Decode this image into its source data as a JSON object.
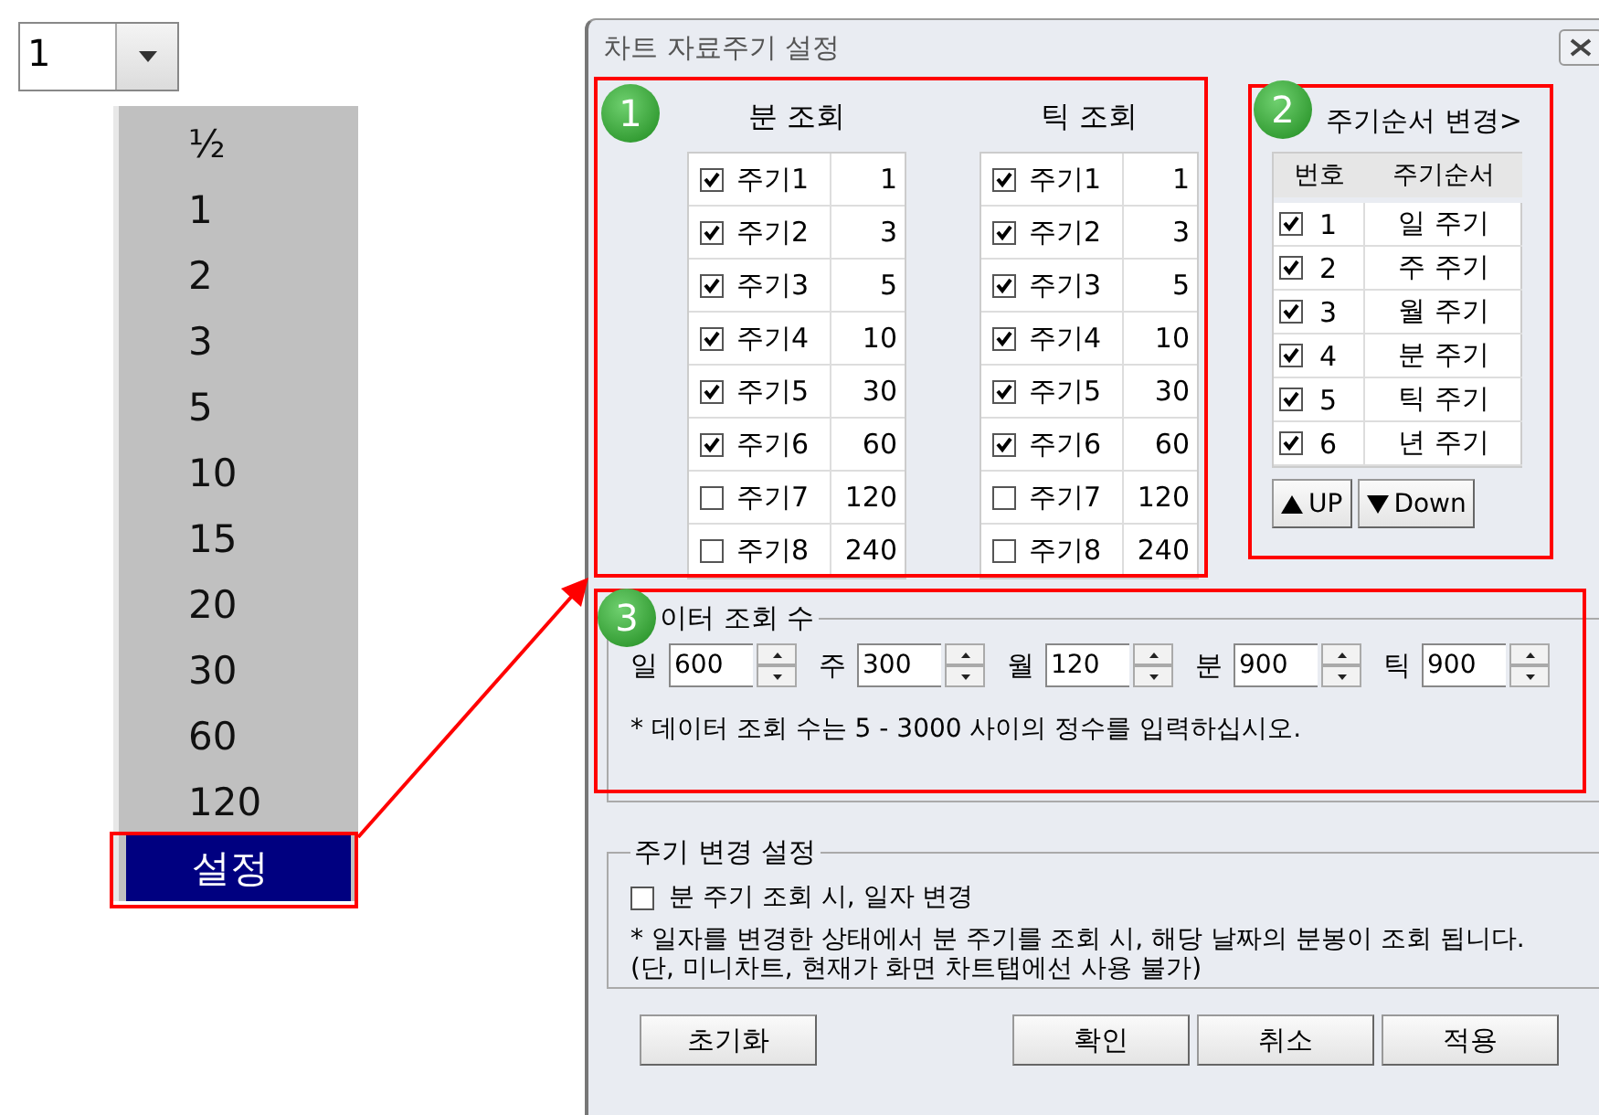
{
  "combo": {
    "value": "1"
  },
  "dropdown": {
    "items": [
      {
        "label": "½",
        "selected": false
      },
      {
        "label": "1",
        "selected": false
      },
      {
        "label": "2",
        "selected": false
      },
      {
        "label": "3",
        "selected": false
      },
      {
        "label": "5",
        "selected": false
      },
      {
        "label": "10",
        "selected": false
      },
      {
        "label": "15",
        "selected": false
      },
      {
        "label": "20",
        "selected": false
      },
      {
        "label": "30",
        "selected": false
      },
      {
        "label": "60",
        "selected": false
      },
      {
        "label": "120",
        "selected": false
      },
      {
        "label": "설정",
        "selected": true
      }
    ]
  },
  "dialog": {
    "title": "차트 자료주기 설정",
    "queries": [
      {
        "heading": "분 조회",
        "rows": [
          {
            "label": "주기1",
            "value": "1",
            "checked": true
          },
          {
            "label": "주기2",
            "value": "3",
            "checked": true
          },
          {
            "label": "주기3",
            "value": "5",
            "checked": true
          },
          {
            "label": "주기4",
            "value": "10",
            "checked": true
          },
          {
            "label": "주기5",
            "value": "30",
            "checked": true
          },
          {
            "label": "주기6",
            "value": "60",
            "checked": true
          },
          {
            "label": "주기7",
            "value": "120",
            "checked": false
          },
          {
            "label": "주기8",
            "value": "240",
            "checked": false
          }
        ]
      },
      {
        "heading": "틱 조회",
        "rows": [
          {
            "label": "주기1",
            "value": "1",
            "checked": true
          },
          {
            "label": "주기2",
            "value": "3",
            "checked": true
          },
          {
            "label": "주기3",
            "value": "5",
            "checked": true
          },
          {
            "label": "주기4",
            "value": "10",
            "checked": true
          },
          {
            "label": "주기5",
            "value": "30",
            "checked": true
          },
          {
            "label": "주기6",
            "value": "60",
            "checked": true
          },
          {
            "label": "주기7",
            "value": "120",
            "checked": false
          },
          {
            "label": "주기8",
            "value": "240",
            "checked": false
          }
        ]
      }
    ],
    "order": {
      "heading": "주기순서 변경>",
      "columns": [
        "번호",
        "주기순서"
      ],
      "rows": [
        {
          "number": "1",
          "name": "일 주기",
          "checked": true
        },
        {
          "number": "2",
          "name": "주 주기",
          "checked": true
        },
        {
          "number": "3",
          "name": "월 주기",
          "checked": true
        },
        {
          "number": "4",
          "name": "분 주기",
          "checked": true
        },
        {
          "number": "5",
          "name": "틱 주기",
          "checked": true
        },
        {
          "number": "6",
          "name": "년 주기",
          "checked": true
        }
      ],
      "buttons": [
        {
          "kind": "up",
          "label": "UP"
        },
        {
          "kind": "down",
          "label": "Down"
        }
      ]
    },
    "data_count": {
      "legend": "이터 조회 수",
      "fields": [
        {
          "label": "일",
          "value": "600"
        },
        {
          "label": "주",
          "value": "300"
        },
        {
          "label": "월",
          "value": "120"
        },
        {
          "label": "분",
          "value": "900"
        },
        {
          "label": "틱",
          "value": "900"
        }
      ],
      "note": "* 데이터 조회 수는 5 - 3000 사이의 정수를 입력하십시오."
    },
    "period_change": {
      "legend": "주기 변경 설정",
      "option": {
        "label": "분 주기 조회 시, 일자 변경",
        "checked": false
      },
      "note": "* 일자를 변경한 상태에서 분 주기를 조회 시, 해당 날짜의 분봉이 조회 됩니다.(단, 미니차트, 현재가 화면 차트탭에선 사용 불가)"
    },
    "buttons": [
      "초기화",
      "확인",
      "취소",
      "적용"
    ]
  },
  "annotations": [
    {
      "label": "1"
    },
    {
      "label": "2"
    },
    {
      "label": "3"
    }
  ]
}
